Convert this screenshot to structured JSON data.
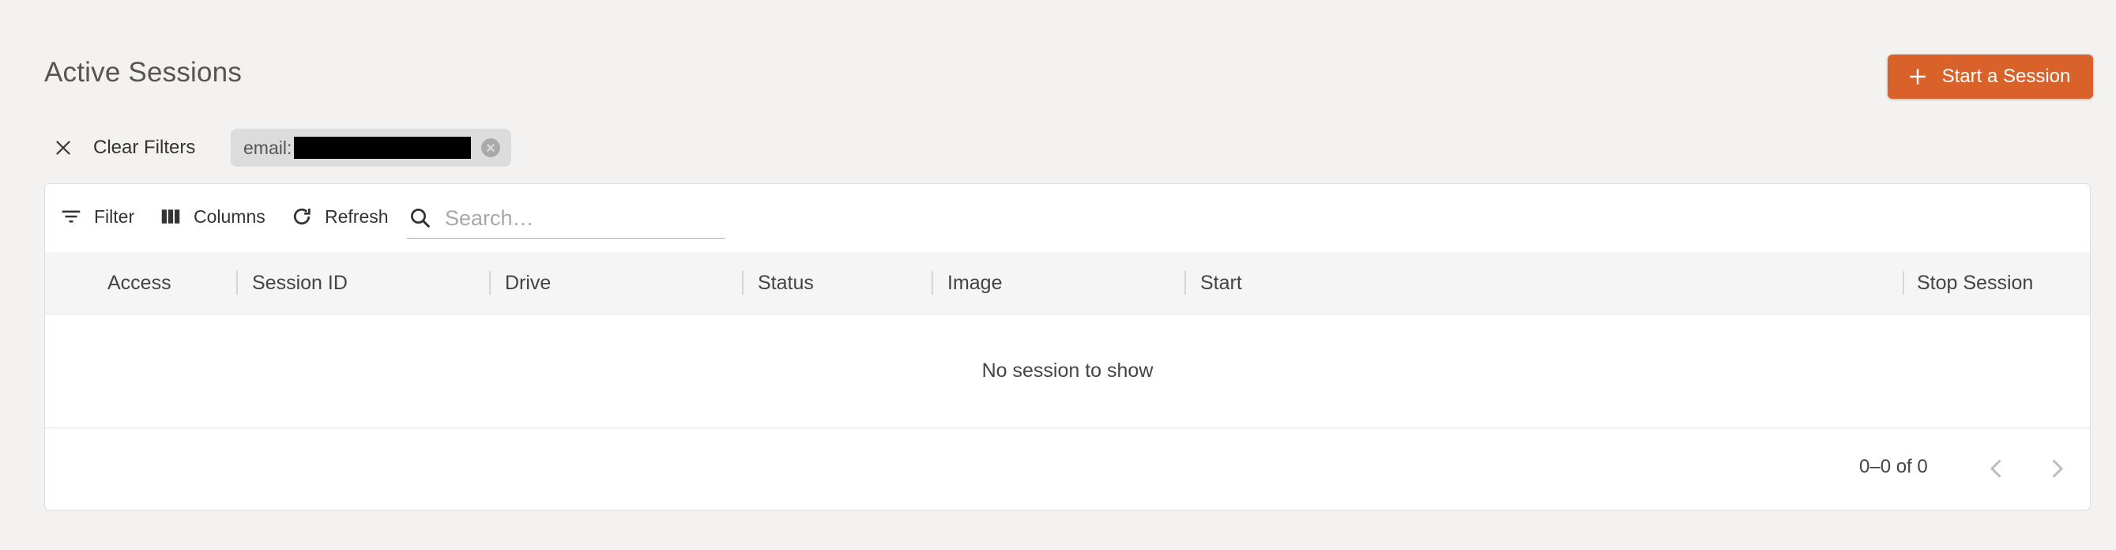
{
  "page": {
    "title": "Active Sessions"
  },
  "actions": {
    "start_session_label": "Start a Session"
  },
  "filters": {
    "clear_label": "Clear Filters",
    "chip_label": "email:"
  },
  "toolbar": {
    "filter_label": "Filter",
    "columns_label": "Columns",
    "refresh_label": "Refresh",
    "search_placeholder": "Search…"
  },
  "table": {
    "columns": [
      "Access",
      "Session ID",
      "Drive",
      "Status",
      "Image",
      "Start",
      "Stop Session"
    ],
    "empty_message": "No session to show"
  },
  "pagination": {
    "range_text": "0–0 of 0"
  },
  "colors": {
    "accent": "#d9622b",
    "background": "#f3f2f0"
  },
  "icons": {
    "start": "plus-icon",
    "clear": "close-icon",
    "chip_delete": "cancel-circle-icon",
    "filter": "filter-list-icon",
    "columns": "view-column-icon",
    "refresh": "refresh-icon",
    "search": "search-icon",
    "prev": "chevron-left-icon",
    "next": "chevron-right-icon"
  }
}
